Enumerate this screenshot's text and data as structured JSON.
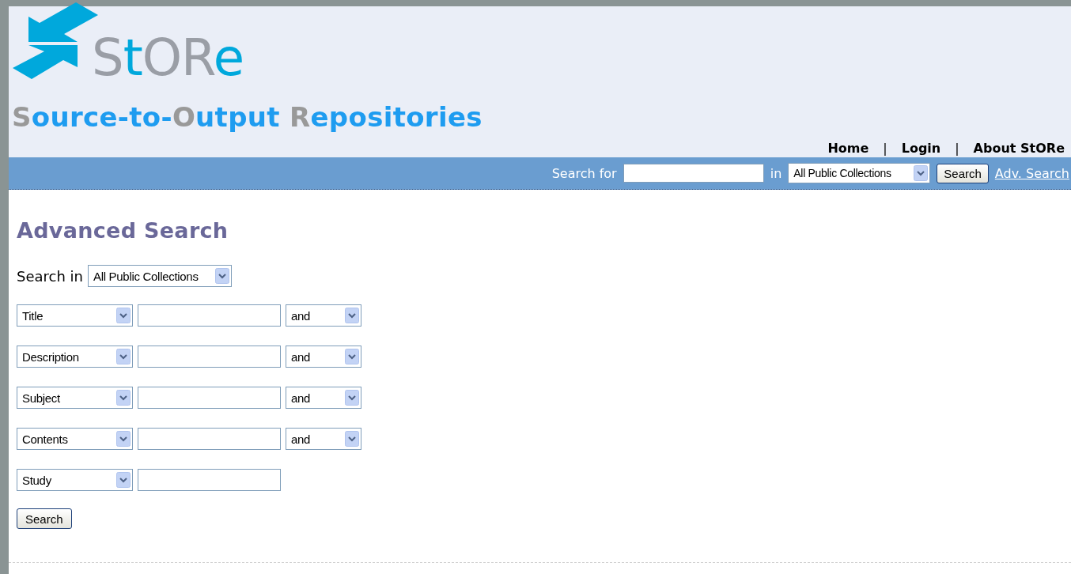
{
  "logo": {
    "parts": [
      {
        "text": "S",
        "color": "#9a9ea6"
      },
      {
        "text": "t",
        "color": "#00a8dc"
      },
      {
        "text": "OR",
        "color": "#9a9ea6"
      },
      {
        "text": "e",
        "color": "#00a8dc"
      }
    ]
  },
  "tagline": {
    "parts": [
      {
        "text": "S",
        "color": "#999999"
      },
      {
        "text": "ource-to-",
        "color": "#1e9cf0"
      },
      {
        "text": "O",
        "color": "#999999"
      },
      {
        "text": "utput ",
        "color": "#1e9cf0"
      },
      {
        "text": "R",
        "color": "#999999"
      },
      {
        "text": "epositories",
        "color": "#1e9cf0"
      }
    ]
  },
  "nav": [
    "Home",
    "Login",
    "About StORe"
  ],
  "nav_separator": "|",
  "quick_search": {
    "label": "Search for",
    "in_label": "in",
    "scope": "All Public Collections",
    "button": "Search",
    "advanced_link": "Adv. Search"
  },
  "page_title": "Advanced Search",
  "search_in": {
    "label": "Search in",
    "scope": "All Public Collections"
  },
  "criteria": [
    {
      "field": "Title",
      "operator": "and"
    },
    {
      "field": "Description",
      "operator": "and"
    },
    {
      "field": "Subject",
      "operator": "and"
    },
    {
      "field": "Contents",
      "operator": "and"
    },
    {
      "field": "Study"
    }
  ],
  "search_button": "Search"
}
